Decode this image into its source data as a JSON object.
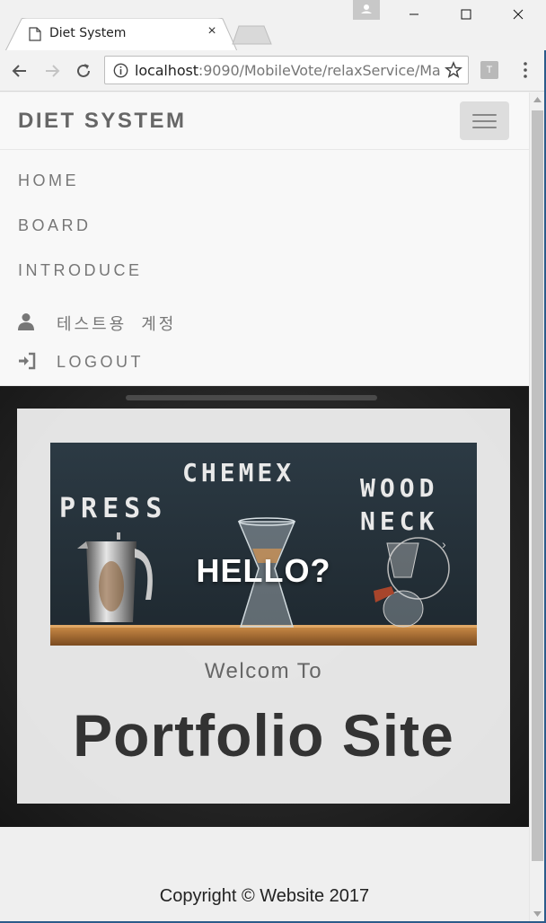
{
  "browser": {
    "tab_title": "Diet System",
    "tab_close": "×",
    "url_host": "localhost",
    "url_rest": ":9090/MobileVote/relaxService/Ma",
    "extension_label": "T"
  },
  "site": {
    "brand": "DIET SYSTEM",
    "nav": {
      "home": "HOME",
      "board": "BOARD",
      "introduce": "INTRODUCE",
      "user": "테스트용  계정",
      "logout": "LOGOUT"
    },
    "hero": {
      "banner_text": "HELLO?",
      "banner_signs": [
        "PRESS",
        "CHEMEX",
        "WOOD",
        "NECK"
      ],
      "welcome": "Welcom To",
      "headline": "Portfolio Site"
    },
    "footer": "Copyright © Website 2017"
  },
  "colors": {
    "navbar_bg": "#f8f8f8",
    "nav_text": "#777777",
    "hero_bg": "#262626",
    "panel_bg": "#f0f0f0",
    "headline": "#333333"
  },
  "icons": [
    "page-icon",
    "back-arrow-icon",
    "forward-arrow-icon",
    "reload-icon",
    "info-icon",
    "star-icon",
    "kebab-menu-icon",
    "user-icon",
    "login-icon",
    "hamburger-icon"
  ]
}
